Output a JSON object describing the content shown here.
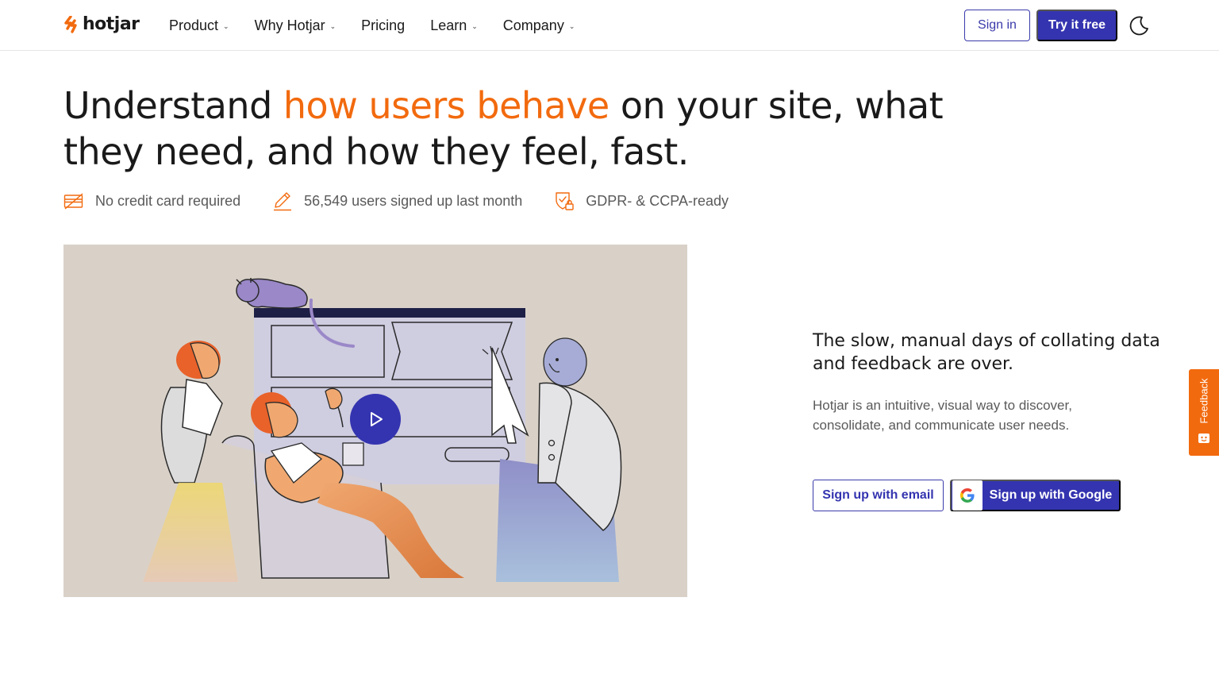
{
  "brand": {
    "name": "hotjar",
    "accent": "#f26a0e",
    "primary": "#3434b0"
  },
  "nav": {
    "items": [
      {
        "label": "Product",
        "has_dropdown": true
      },
      {
        "label": "Why Hotjar",
        "has_dropdown": true
      },
      {
        "label": "Pricing",
        "has_dropdown": false
      },
      {
        "label": "Learn",
        "has_dropdown": true
      },
      {
        "label": "Company",
        "has_dropdown": true
      }
    ],
    "dropdown_glyph": "⌄",
    "signin_label": "Sign in",
    "try_label": "Try it free",
    "theme_icon": "moon-icon"
  },
  "hero": {
    "headline_before": "Understand ",
    "headline_accent": "how users behave",
    "headline_after": " on your site, what they need, and how they feel, fast.",
    "perks": [
      {
        "icon": "credit-card-crossed-icon",
        "text": "No credit card required"
      },
      {
        "icon": "pencil-icon",
        "text": "56,549 users signed up last month"
      },
      {
        "icon": "shield-lock-icon",
        "text": "GDPR- & CCPA-ready"
      }
    ]
  },
  "video": {
    "play_icon": "play-icon"
  },
  "cta": {
    "subhead": "The slow, manual days of collating data and feedback are over.",
    "description": "Hotjar is an intuitive, visual way to discover, consolidate, and communicate user needs.",
    "email_button": "Sign up with email",
    "google_button": "Sign up with Google"
  },
  "feedback_tab": {
    "label": "Feedback"
  }
}
